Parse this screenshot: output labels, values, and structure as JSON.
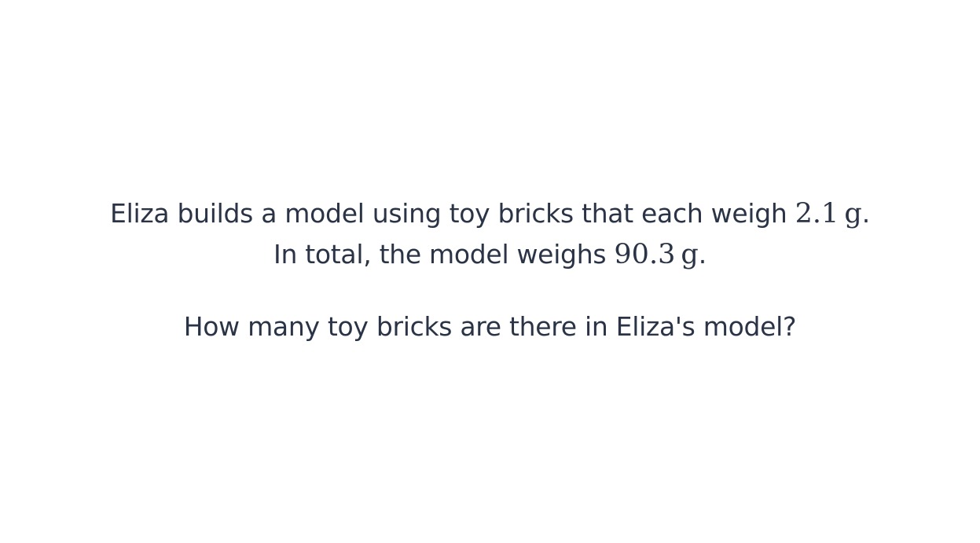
{
  "problem": {
    "line1": {
      "prefix": "Eliza builds a model using toy bricks that each weigh ",
      "value": "2.1",
      "unit": "g",
      "suffix": "."
    },
    "line2": {
      "prefix": "In total, the model weighs ",
      "value": "90.3",
      "unit": "g",
      "suffix": "."
    },
    "question": "How many toy bricks are there in Eliza's model?"
  },
  "colors": {
    "text": "#2b3446",
    "background": "#ffffff"
  }
}
